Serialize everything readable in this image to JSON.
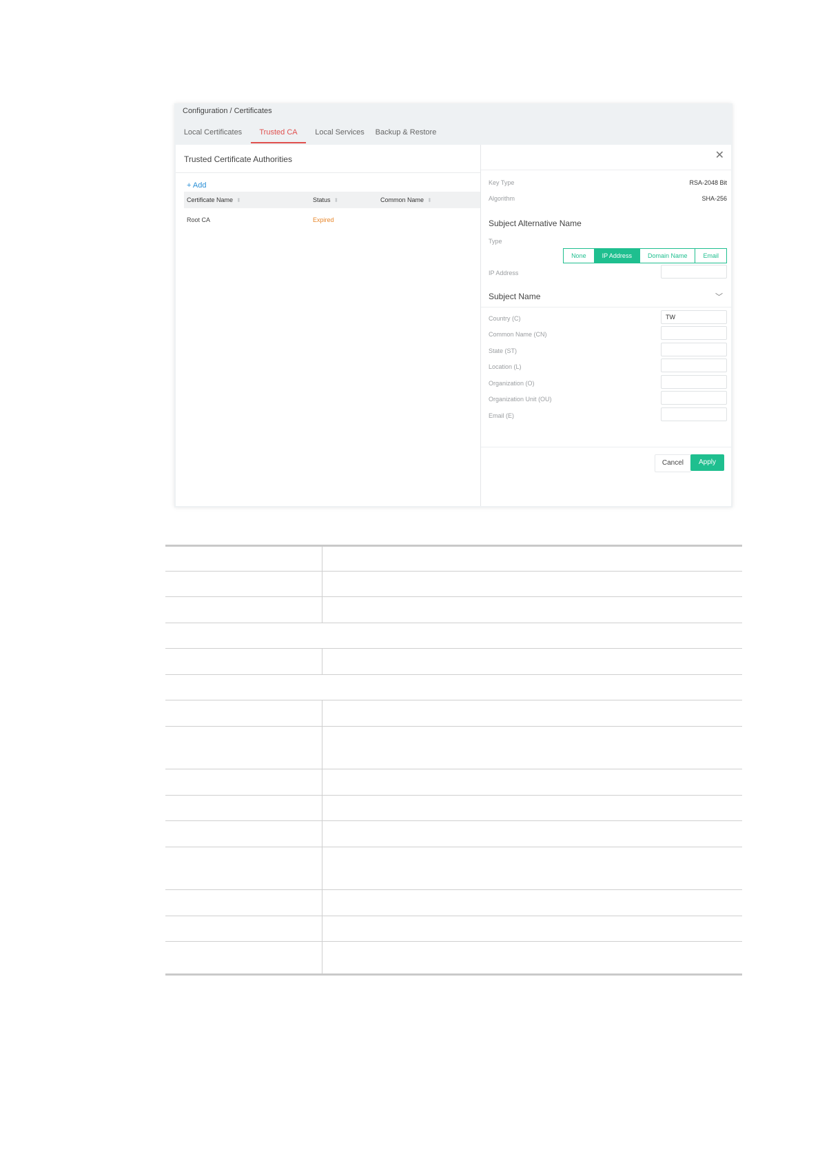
{
  "breadcrumb": "Configuration / Certificates",
  "tabs": [
    {
      "label": "Local Certificates",
      "active": false
    },
    {
      "label": "Trusted CA",
      "active": true
    },
    {
      "label": "Local Services",
      "active": false
    },
    {
      "label": "Backup & Restore",
      "active": false
    }
  ],
  "left_panel": {
    "title": "Trusted Certificate Authorities",
    "add_label": "+ Add",
    "columns": [
      "Certificate Name",
      "Status",
      "Common Name"
    ],
    "rows": [
      {
        "certificate_name": "Root CA",
        "status": "Expired",
        "common_name": ""
      }
    ]
  },
  "right_panel": {
    "key_type_label": "Key Type",
    "key_type_value": "RSA-2048 Bit",
    "algorithm_label": "Algorithm",
    "algorithm_value": "SHA-256",
    "san_title": "Subject Alternative Name",
    "type_label": "Type",
    "type_options": [
      "None",
      "IP Address",
      "Domain Name",
      "Email"
    ],
    "type_selected": "IP Address",
    "ip_address_label": "IP Address",
    "subject_title": "Subject Name",
    "fields": [
      {
        "label": "Country",
        "hint": "(C)",
        "value": "TW"
      },
      {
        "label": "Common Name",
        "hint": "(CN)",
        "value": ""
      },
      {
        "label": "State",
        "hint": "(ST)",
        "value": ""
      },
      {
        "label": "Location",
        "hint": "(L)",
        "value": ""
      },
      {
        "label": "Organization",
        "hint": "(O)",
        "value": ""
      },
      {
        "label": "Organization Unit",
        "hint": "(OU)",
        "value": ""
      },
      {
        "label": "Email",
        "hint": "(E)",
        "value": ""
      }
    ],
    "cancel_label": "Cancel",
    "apply_label": "Apply"
  },
  "colors": {
    "accent": "#1fbf8f",
    "active_tab": "#e0504e",
    "status_expired": "#e8872b",
    "link": "#2a8fd6"
  }
}
